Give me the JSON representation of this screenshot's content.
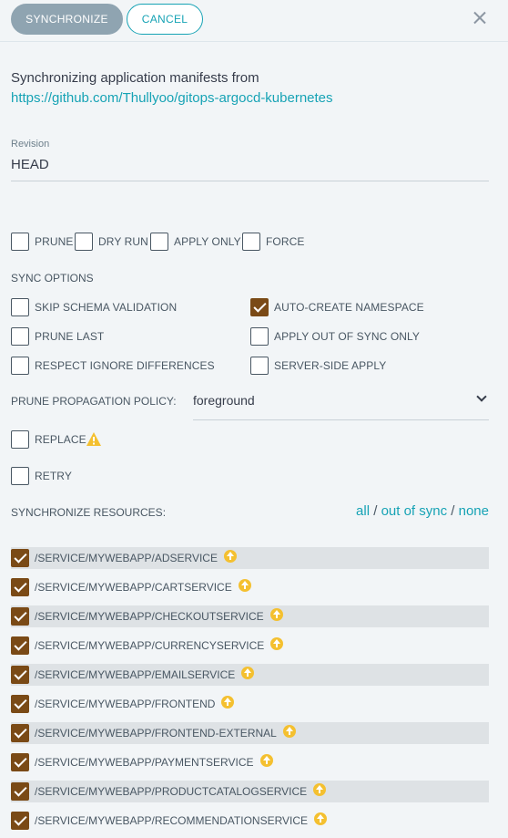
{
  "header": {
    "synchronize_label": "SYNCHRONIZE",
    "cancel_label": "CANCEL",
    "close_icon": "close-icon"
  },
  "intro": {
    "text": "Synchronizing application manifests from",
    "repo_url": "https://github.com/Thullyoo/gitops-argocd-kubernetes"
  },
  "revision": {
    "label": "Revision",
    "value": "HEAD"
  },
  "top_options": [
    {
      "label": "PRUNE",
      "checked": false
    },
    {
      "label": "DRY RUN",
      "checked": false
    },
    {
      "label": "APPLY ONLY",
      "checked": false
    },
    {
      "label": "FORCE",
      "checked": false
    }
  ],
  "sync_options": {
    "title": "SYNC OPTIONS",
    "items": [
      {
        "label": "SKIP SCHEMA VALIDATION",
        "checked": false
      },
      {
        "label": "AUTO-CREATE NAMESPACE",
        "checked": true
      },
      {
        "label": "PRUNE LAST",
        "checked": false
      },
      {
        "label": "APPLY OUT OF SYNC ONLY",
        "checked": false
      },
      {
        "label": "RESPECT IGNORE DIFFERENCES",
        "checked": false
      },
      {
        "label": "SERVER-SIDE APPLY",
        "checked": false
      }
    ]
  },
  "prune_policy": {
    "label": "PRUNE PROPAGATION POLICY:",
    "value": "foreground"
  },
  "replace": {
    "label": "REPLACE",
    "checked": false,
    "icon": "warning-icon"
  },
  "retry": {
    "label": "RETRY",
    "checked": false
  },
  "resources": {
    "title": "SYNCHRONIZE RESOURCES:",
    "filter_all": "all",
    "filter_out_of_sync": "out of sync",
    "filter_none": "none",
    "separator": "/",
    "items": [
      {
        "label": "/SERVICE/MYWEBAPP/ADSERVICE",
        "checked": true
      },
      {
        "label": "/SERVICE/MYWEBAPP/CARTSERVICE",
        "checked": true
      },
      {
        "label": "/SERVICE/MYWEBAPP/CHECKOUTSERVICE",
        "checked": true
      },
      {
        "label": "/SERVICE/MYWEBAPP/CURRENCYSERVICE",
        "checked": true
      },
      {
        "label": "/SERVICE/MYWEBAPP/EMAILSERVICE",
        "checked": true
      },
      {
        "label": "/SERVICE/MYWEBAPP/FRONTEND",
        "checked": true
      },
      {
        "label": "/SERVICE/MYWEBAPP/FRONTEND-EXTERNAL",
        "checked": true
      },
      {
        "label": "/SERVICE/MYWEBAPP/PAYMENTSERVICE",
        "checked": true
      },
      {
        "label": "/SERVICE/MYWEBAPP/PRODUCTCATALOGSERVICE",
        "checked": true
      },
      {
        "label": "/SERVICE/MYWEBAPP/RECOMMENDATIONSERVICE",
        "checked": true
      }
    ]
  },
  "colors": {
    "accent": "#17a3b5",
    "checkbox_checked": "#7a4a16",
    "out_of_sync_icon": "#f4c030"
  }
}
